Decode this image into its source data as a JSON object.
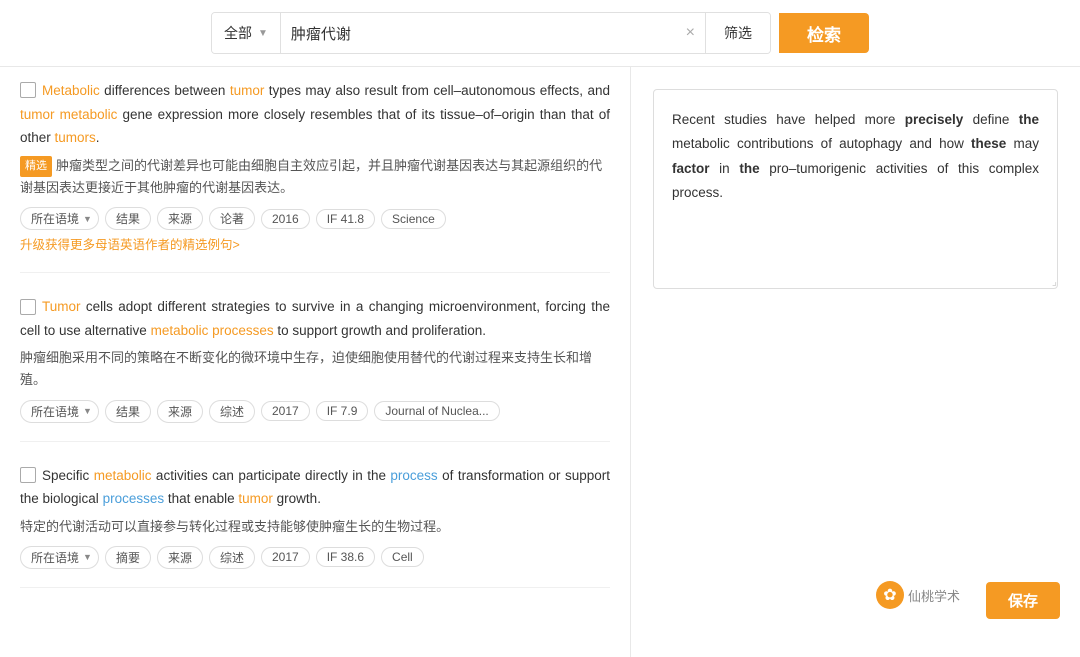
{
  "search": {
    "category": "全部",
    "category_arrow": "▼",
    "query": "肿瘤代谢",
    "clear_btn": "×",
    "filter_btn": "筛选",
    "search_btn": "检索"
  },
  "results": [
    {
      "id": "r1",
      "english": {
        "parts": [
          {
            "text": "Metabolic",
            "style": "orange"
          },
          {
            "text": " differences between ",
            "style": "normal"
          },
          {
            "text": "tumor",
            "style": "orange"
          },
          {
            "text": " types may also result from cell–autonomous effects, and ",
            "style": "normal"
          },
          {
            "text": "tumor",
            "style": "orange"
          },
          {
            "text": " ",
            "style": "normal"
          },
          {
            "text": "metabolic",
            "style": "orange"
          },
          {
            "text": " gene expression more closely resembles that of its tissue–of–origin than that of other ",
            "style": "normal"
          },
          {
            "text": "tumors",
            "style": "orange"
          },
          {
            "text": ".",
            "style": "normal"
          }
        ]
      },
      "badge": "精选",
      "translation": "肿瘤类型之间的代谢差异也可能由细胞自主效应引起，并且肿瘤代谢基因表达与其起源组织的代谢基因表达更接近于其他肿瘤的代谢基因表达。",
      "translation_highlights": [
        "代谢",
        "肿瘤代谢",
        "代谢",
        "肿瘤",
        "代谢"
      ],
      "tags": [
        "所在语境",
        "结果",
        "来源",
        "论著",
        "2016",
        "IF 41.8",
        "Science"
      ],
      "tags_with_arrow": [
        "所在语境"
      ],
      "upgrade_text": "升级获得更多母语英语作者的精选例句>"
    },
    {
      "id": "r2",
      "english": {
        "parts": [
          {
            "text": "Tumor",
            "style": "orange"
          },
          {
            "text": " cells adopt different strategies to survive in a changing microenvironment, forcing the cell to use alternative ",
            "style": "normal"
          },
          {
            "text": "metabolic processes",
            "style": "orange"
          },
          {
            "text": " to support growth and proliferation.",
            "style": "normal"
          }
        ]
      },
      "badge": null,
      "translation": "肿瘤细胞采用不同的策略在不断变化的微环境中生存，迫使细胞使用替代的代谢过程来支持生长和增殖。",
      "translation_highlights": [
        "肿瘤",
        "代谢"
      ],
      "tags": [
        "所在语境",
        "结果",
        "来源",
        "综述",
        "2017",
        "IF 7.9",
        "Journal of Nuclea..."
      ],
      "tags_with_arrow": [
        "所在语境"
      ]
    },
    {
      "id": "r3",
      "english": {
        "parts": [
          {
            "text": "Specific ",
            "style": "normal"
          },
          {
            "text": "metabolic",
            "style": "orange"
          },
          {
            "text": " activities can participate directly in the ",
            "style": "normal"
          },
          {
            "text": "process",
            "style": "blue"
          },
          {
            "text": " of transformation or support the biological ",
            "style": "normal"
          },
          {
            "text": "processes",
            "style": "blue"
          },
          {
            "text": " that enable ",
            "style": "normal"
          },
          {
            "text": "tumor",
            "style": "orange"
          },
          {
            "text": " growth.",
            "style": "normal"
          }
        ]
      },
      "badge": null,
      "translation": "特定的代谢活动可以直接参与转化过程或支持能够使肿瘤生长的生物过程。",
      "translation_highlights": [
        "代谢",
        "肿瘤"
      ],
      "tags": [
        "所在语境",
        "摘要",
        "来源",
        "综述",
        "2017",
        "IF 38.6",
        "Cell"
      ],
      "tags_with_arrow": [
        "所在语境"
      ]
    }
  ],
  "right_panel": {
    "text_parts": [
      {
        "text": "Recent studies have helped more ",
        "style": "normal"
      },
      {
        "text": "precisely",
        "style": "normal"
      },
      {
        "text": " define ",
        "style": "normal"
      },
      {
        "text": "the",
        "style": "normal"
      },
      {
        "text": " metabolic contributions of autophagy and how ",
        "style": "normal"
      },
      {
        "text": "these",
        "style": "normal"
      },
      {
        "text": " may ",
        "style": "normal"
      },
      {
        "text": "factor",
        "style": "normal"
      },
      {
        "text": " in ",
        "style": "normal"
      },
      {
        "text": "the",
        "style": "normal"
      },
      {
        "text": " pro–tumorigenic activities of this complex process.",
        "style": "normal"
      }
    ],
    "full_text": "Recent studies have helped more precisely define the metabolic contributions of autophagy and how these may factor in the pro–tumorigenic activities of this complex process."
  },
  "watermark": {
    "icon": "✿",
    "text": "仙桃学术"
  },
  "save_btn": "保存"
}
